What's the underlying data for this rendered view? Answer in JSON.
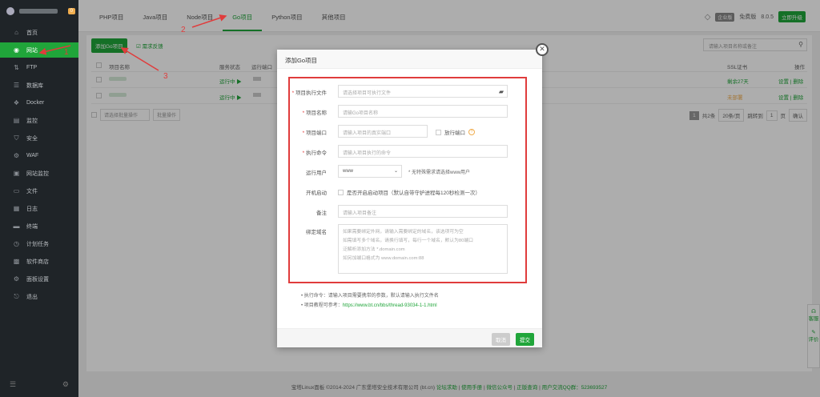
{
  "sidebar": {
    "badge": "0",
    "items": [
      {
        "label": "首页",
        "icon": "home-icon",
        "glyph": "⌂"
      },
      {
        "label": "网站",
        "icon": "globe-icon",
        "glyph": "◉",
        "active": true
      },
      {
        "label": "FTP",
        "icon": "ftp-icon",
        "glyph": "⇅"
      },
      {
        "label": "数据库",
        "icon": "database-icon",
        "glyph": "☰"
      },
      {
        "label": "Docker",
        "icon": "docker-icon",
        "glyph": "❖"
      },
      {
        "label": "监控",
        "icon": "monitor-icon",
        "glyph": "▤"
      },
      {
        "label": "安全",
        "icon": "shield-icon",
        "glyph": "⛉"
      },
      {
        "label": "WAF",
        "icon": "waf-icon",
        "glyph": "⚙"
      },
      {
        "label": "网站监控",
        "icon": "site-monitor-icon",
        "glyph": "▣"
      },
      {
        "label": "文件",
        "icon": "folder-icon",
        "glyph": "▭"
      },
      {
        "label": "日志",
        "icon": "log-icon",
        "glyph": "▦"
      },
      {
        "label": "终端",
        "icon": "terminal-icon",
        "glyph": "▬"
      },
      {
        "label": "计划任务",
        "icon": "task-icon",
        "glyph": "◷"
      },
      {
        "label": "软件商店",
        "icon": "store-icon",
        "glyph": "▩"
      },
      {
        "label": "面板设置",
        "icon": "settings-icon",
        "glyph": "⚙"
      },
      {
        "label": "退出",
        "icon": "logout-icon",
        "glyph": "⎋"
      }
    ]
  },
  "tabs": [
    "PHP项目",
    "Java项目",
    "Node项目",
    "Go项目",
    "Python项目",
    "其他项目"
  ],
  "active_tab": "Go项目",
  "topright": {
    "tag": "企业版",
    "free": "免费版",
    "version": "8.0.5",
    "upgrade": "立即升级"
  },
  "toolbar": {
    "add_go": "添加Go项目",
    "sync": "需求反馈",
    "search_placeholder": "请输入项目名称或备注"
  },
  "table": {
    "headers": [
      "项目名称",
      "服务状态",
      "运行端口",
      "SSL证书",
      "操作"
    ],
    "rows": [
      {
        "status": "运行中 ▶",
        "ssl": "剩余27天",
        "ops": "设置 | 删除"
      },
      {
        "status": "运行中 ▶",
        "ssl": "未部署",
        "ops": "设置 | 删除"
      }
    ],
    "batch_select": "请选择批量操作",
    "batch_button": "批量操作",
    "pager": {
      "current": "1",
      "total": "共2条",
      "per_page": "20条/页",
      "jump": "跳转到",
      "page_input": "1",
      "page_unit": "页",
      "confirm": "确认"
    }
  },
  "modal": {
    "title": "添加Go项目",
    "fields": {
      "exec_file": {
        "label": "项目执行文件",
        "placeholder": "请选择项目可执行文件"
      },
      "name": {
        "label": "项目名称",
        "placeholder": "请输Go项目名称"
      },
      "port": {
        "label": "项目端口",
        "placeholder": "请输入项目的真实端口",
        "release": "放行端口"
      },
      "command": {
        "label": "执行命令",
        "placeholder": "请输入项目执行的命令"
      },
      "user": {
        "label": "运行用户",
        "value": "www",
        "note": "* 无特殊需求请选择www用户"
      },
      "boot": {
        "label": "开机启动",
        "text": "是否开启启动项目（默认自带守护进程每120秒检测一次）"
      },
      "remark": {
        "label": "备注",
        "placeholder": "请输入项目备注"
      },
      "domain": {
        "label": "绑定域名",
        "lines": [
          "如果需要绑定外网，请输入需要绑定的域名，该选项可为空",
          "如需填写多个域名，请换行填写，每行一个域名，默认为80端口",
          "泛解析添加方法 *.domain.com",
          "如另加端口格式为 www.domain.com:88"
        ]
      }
    },
    "tips": [
      {
        "text": "执行命令：请输入项目需要携带的参数，默认请输入执行文件名"
      },
      {
        "text": "项目教程可参考：",
        "link": "https://www.bt.cn/bbs/thread-93034-1-1.html"
      }
    ],
    "cancel": "取消",
    "submit": "提交"
  },
  "footer": {
    "copyright": "宝塔Linux面板 ©2014-2024 广东堡塔安全技术有限公司 (bt.cn)",
    "links": [
      "论坛求助",
      "使用手册",
      "微信公众号",
      "正版查询"
    ],
    "qq": "用户交流QQ群：523693527"
  },
  "annotations": [
    "1",
    "2",
    "3"
  ],
  "side_panel": [
    "客服",
    "评价"
  ]
}
